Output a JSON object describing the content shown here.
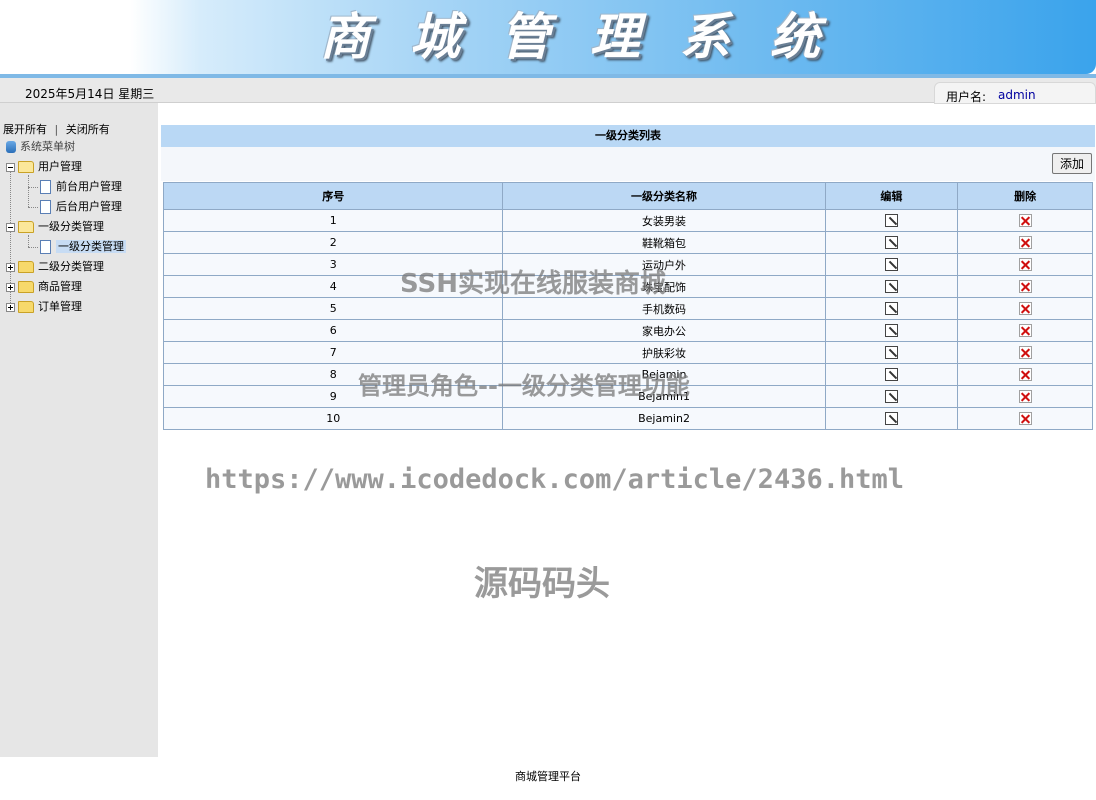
{
  "header": {
    "banner_title": "商城管理系统",
    "date_text": "2025年5月14日 星期三",
    "user_label": "用户名:",
    "user_name": "admin"
  },
  "sidebar": {
    "expand_all": "展开所有",
    "separator": "|",
    "collapse_all": "关闭所有",
    "root_label": "系统菜单树",
    "groups": [
      {
        "label": "用户管理",
        "expanded": true,
        "children": [
          "前台用户管理",
          "后台用户管理"
        ]
      },
      {
        "label": "一级分类管理",
        "expanded": true,
        "children": [
          "一级分类管理"
        ]
      },
      {
        "label": "二级分类管理",
        "expanded": false,
        "children": []
      },
      {
        "label": "商品管理",
        "expanded": false,
        "children": []
      },
      {
        "label": "订单管理",
        "expanded": false,
        "children": []
      }
    ],
    "selected": "一级分类管理"
  },
  "main": {
    "list_title": "一级分类列表",
    "add_button": "添加",
    "columns": [
      "序号",
      "一级分类名称",
      "编辑",
      "删除"
    ],
    "rows": [
      {
        "id": "1",
        "name": "女装男装"
      },
      {
        "id": "2",
        "name": "鞋靴箱包"
      },
      {
        "id": "3",
        "name": "运动户外"
      },
      {
        "id": "4",
        "name": "珠宝配饰"
      },
      {
        "id": "5",
        "name": "手机数码"
      },
      {
        "id": "6",
        "name": "家电办公"
      },
      {
        "id": "7",
        "name": "护肤彩妆"
      },
      {
        "id": "8",
        "name": "Bejamin"
      },
      {
        "id": "9",
        "name": "Bejamin1"
      },
      {
        "id": "10",
        "name": "Bejamin2"
      }
    ]
  },
  "footer": {
    "text": "商城管理平台"
  },
  "watermarks": {
    "line1": "SSH实现在线服装商城",
    "line2": "管理员角色--一级分类管理功能",
    "line3": "https://www.icodedock.com/article/2436.html",
    "line4": "源码码头"
  },
  "icons": {
    "edit": "edit-pencil-icon",
    "delete": "delete-x-icon",
    "folder": "folder-icon",
    "page": "page-icon"
  }
}
